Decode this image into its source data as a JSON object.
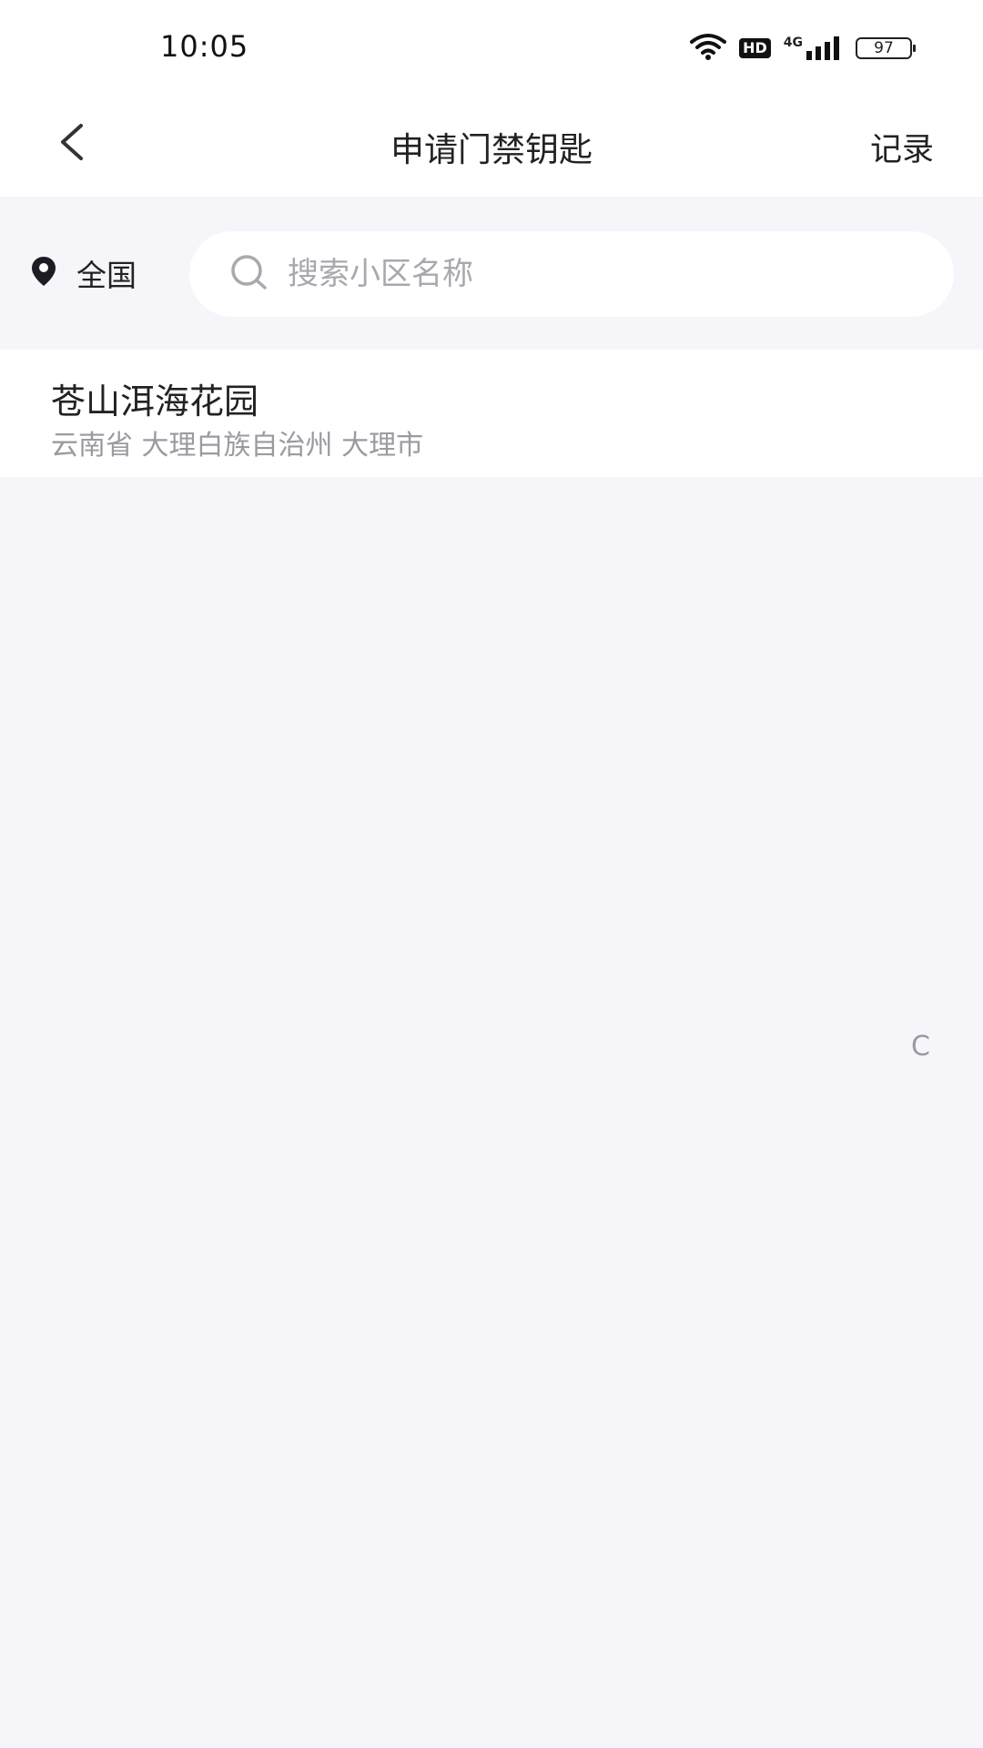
{
  "status_bar": {
    "time": "10:05",
    "hd": "HD",
    "network": "4G",
    "battery": "97",
    "icons": [
      "wifi-icon",
      "hd-icon",
      "signal-icon",
      "battery-icon"
    ]
  },
  "nav": {
    "title": "申请门禁钥匙",
    "record_label": "记录",
    "back_icon": "chevron-left-icon"
  },
  "search": {
    "location_label": "全国",
    "location_icon": "map-pin-icon",
    "search_icon": "search-icon",
    "placeholder": "搜索小区名称",
    "value": ""
  },
  "results": [
    {
      "name": "苍山洱海花园",
      "address": "云南省 大理白族自治州 大理市"
    }
  ],
  "index_bar": {
    "letters": [
      "C"
    ]
  },
  "colors": {
    "page_background": "#f5f5fa",
    "surface": "#ffffff",
    "text_primary": "#222222",
    "text_secondary": "#9a9aa0",
    "placeholder": "#a8a8ae"
  }
}
